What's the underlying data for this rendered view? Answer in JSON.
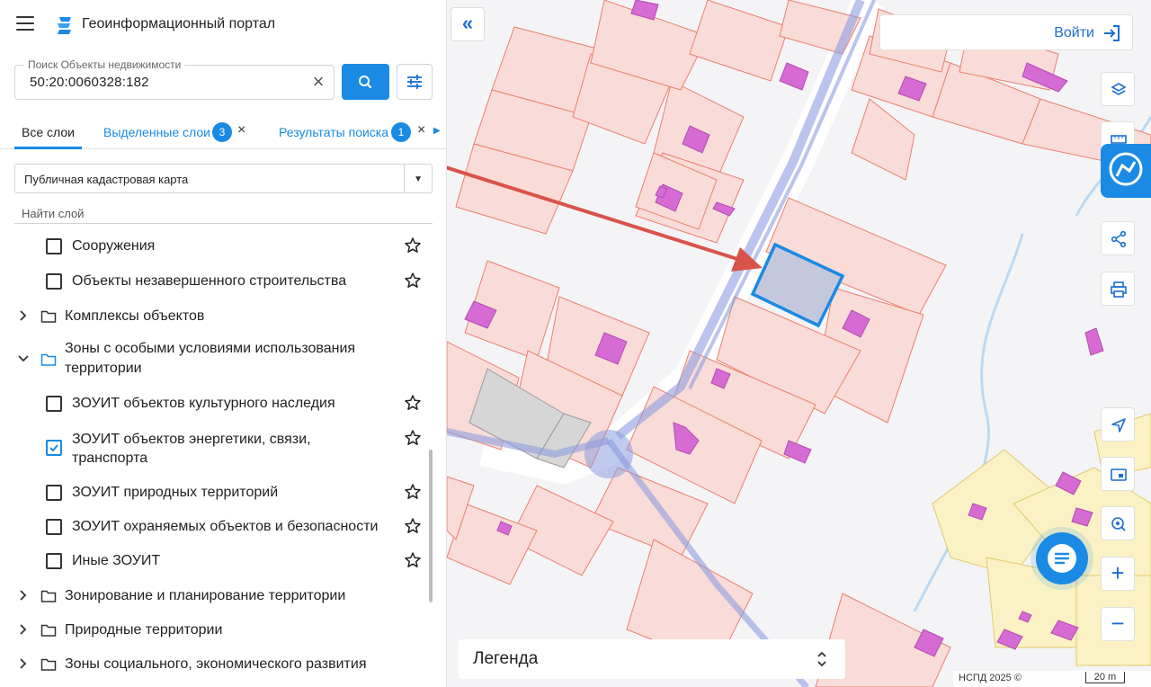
{
  "header": {
    "title": "Геоинформационный портал"
  },
  "search": {
    "label": "Поиск Объекты недвижимости",
    "value": "50:20:0060328:182"
  },
  "tabs": {
    "all": "Все слои",
    "selected": "Выделенные слои",
    "selected_count": "3",
    "results": "Результаты поиска",
    "results_count": "1"
  },
  "basemap_select": {
    "value": "Публичная кадастровая карта"
  },
  "layer_search": {
    "placeholder": "Найти слой"
  },
  "layers": [
    {
      "label": "Сооружения",
      "kind": "checkbox",
      "checked": false
    },
    {
      "label": "Объекты незавершенного строительства",
      "kind": "checkbox",
      "checked": false
    },
    {
      "label": "Комплексы объектов",
      "kind": "folder",
      "expanded": false
    },
    {
      "label": "Зоны с особыми условиями использования территории",
      "kind": "folder",
      "expanded": true
    },
    {
      "label": "ЗОУИТ объектов культурного наследия",
      "kind": "checkbox",
      "checked": false
    },
    {
      "label": "ЗОУИТ объектов энергетики, связи, транспорта",
      "kind": "checkbox",
      "checked": true
    },
    {
      "label": "ЗОУИТ природных территорий",
      "kind": "checkbox",
      "checked": false
    },
    {
      "label": "ЗОУИТ охраняемых объектов и безопасности",
      "kind": "checkbox",
      "checked": false
    },
    {
      "label": "Иные ЗОУИТ",
      "kind": "checkbox",
      "checked": false
    },
    {
      "label": "Зонирование и планирование территории",
      "kind": "folder",
      "expanded": false
    },
    {
      "label": "Природные территории",
      "kind": "folder",
      "expanded": false
    },
    {
      "label": "Зоны социального, экономического развития",
      "kind": "folder",
      "expanded": false
    }
  ],
  "map": {
    "login_label": "Войти",
    "legend_label": "Легенда",
    "attribution": "НСПД 2025 ©",
    "scale": "20 m",
    "toolbar": [
      "layers-icon",
      "ruler-icon",
      "share-icon",
      "print-icon",
      "locate-icon",
      "minimap-icon",
      "search-location-icon",
      "zoom-in",
      "zoom-out"
    ]
  },
  "colors": {
    "accent": "#1a8ae5",
    "parcel_fill": "#f9dcd7",
    "parcel_stroke": "#ec7f6e",
    "building": "#d56bd3",
    "selected_parcel": "#1a8ae5",
    "arrow": "#d9534a"
  }
}
